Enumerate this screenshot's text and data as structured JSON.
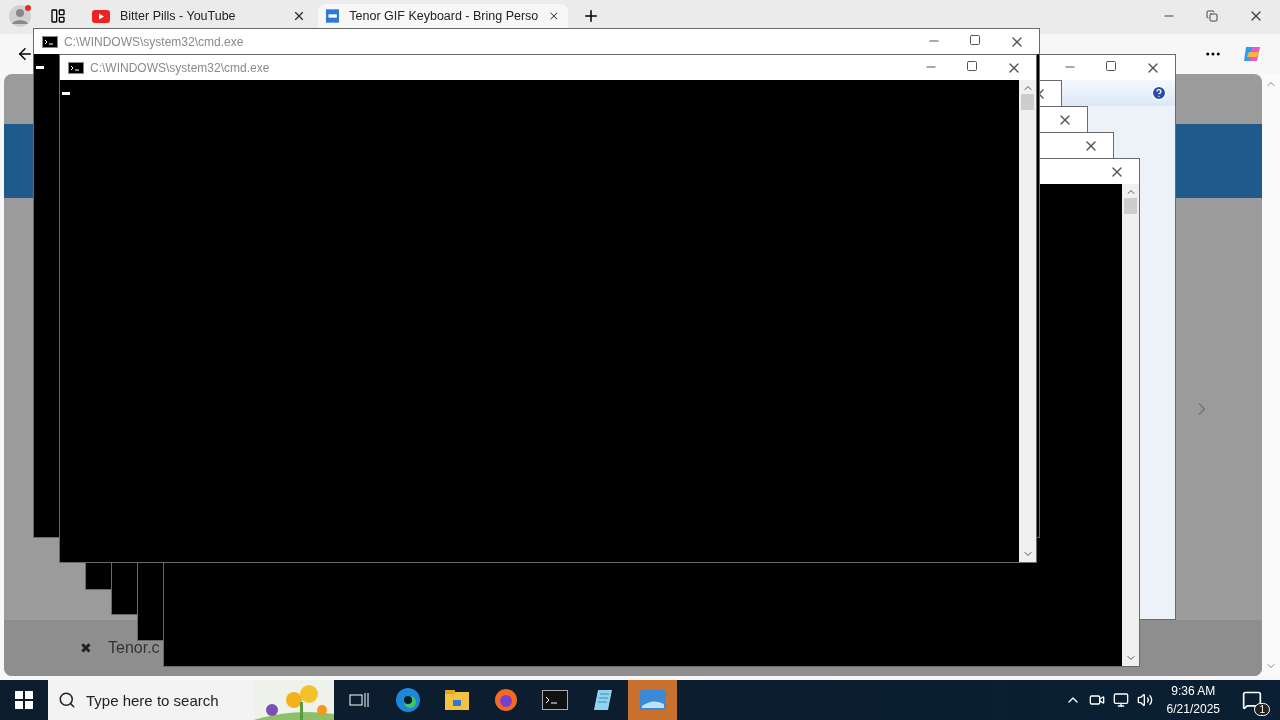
{
  "browser": {
    "tabs": [
      {
        "title": "Bitter Pills - YouTube",
        "selected": false
      },
      {
        "title": "Tenor GIF Keyboard - Bring Perso",
        "selected": true
      }
    ],
    "bottom_bar": {
      "close": "✖",
      "text": "Tenor.c"
    }
  },
  "windows": [
    {
      "kind": "dialog"
    },
    {
      "kind": "console"
    },
    {
      "kind": "console"
    },
    {
      "kind": "console"
    },
    {
      "kind": "console"
    },
    {
      "kind": "console",
      "title": "C:\\WINDOWS\\system32\\cmd.exe"
    },
    {
      "kind": "console",
      "title": "C:\\WINDOWS\\system32\\cmd.exe"
    }
  ],
  "taskbar": {
    "search": {
      "placeholder": "Type here to search"
    },
    "time": "9:36 AM",
    "date": "6/21/2025",
    "notifications": "1"
  }
}
